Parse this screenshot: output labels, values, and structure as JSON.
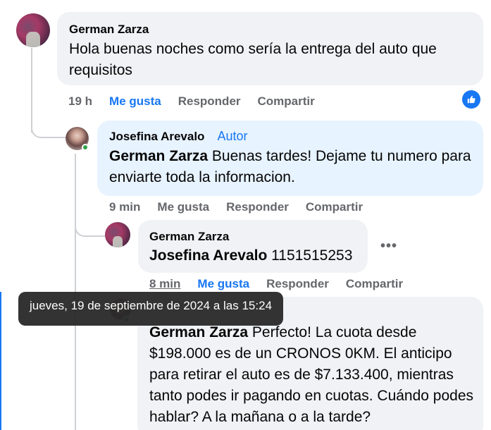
{
  "comments": [
    {
      "author": "German Zarza",
      "text": "Hola buenas noches como sería la entrega del auto que requisitos",
      "time": "19 h",
      "like_label": "Me gusta",
      "reply_label": "Responder",
      "share_label": "Compartir"
    },
    {
      "author": "Josefina Arevalo",
      "tag": "Autor",
      "mention": "German Zarza",
      "text": "Buenas tardes! Dejame tu numero para enviarte toda la informacion.",
      "time": "9 min",
      "like_label": "Me gusta",
      "reply_label": "Responder",
      "share_label": "Compartir"
    },
    {
      "author": "German Zarza",
      "mention": "Josefina Arevalo",
      "text": "1151515253",
      "time": "8 min",
      "like_label": "Me gusta",
      "reply_label": "Responder",
      "share_label": "Compartir"
    },
    {
      "mention": "German Zarza",
      "text": "Perfecto! La cuota desde $198.000 es de un CRONOS 0KM. El anticipo para retirar el auto es de $7.133.400, mientras tanto podes ir pagando en cuotas. Cuándo podes hablar? A la mañana o a la tarde?"
    }
  ],
  "tooltip": "jueves, 19 de septiembre de 2024 a las 15:24",
  "more_label": "•••",
  "icons": {
    "like_badge": "like-thumb-icon",
    "more": "more-options-icon"
  },
  "colors": {
    "accent": "#1877f2",
    "bubble_gray": "#f0f2f5",
    "bubble_blue": "#e7f3ff",
    "online": "#31a24c"
  }
}
